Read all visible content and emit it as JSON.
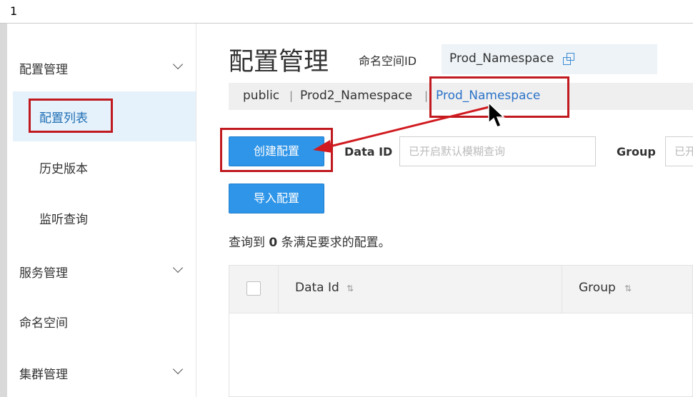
{
  "window": {
    "title_number": "1"
  },
  "sidebar": {
    "groups": [
      {
        "label": "配置管理"
      },
      {
        "label": "服务管理"
      },
      {
        "label": "命名空间"
      },
      {
        "label": "集群管理"
      }
    ],
    "items": [
      {
        "label": "配置列表",
        "active": true
      },
      {
        "label": "历史版本"
      },
      {
        "label": "监听查询"
      }
    ]
  },
  "header": {
    "title": "配置管理",
    "namespace_label": "命名空间ID",
    "namespace_value": "Prod_Namespace"
  },
  "namespace_tabs": [
    {
      "label": "public"
    },
    {
      "label": "Prod2_Namespace"
    },
    {
      "label": "Prod_Namespace",
      "active": true
    }
  ],
  "namespace_separator": "|",
  "toolbar": {
    "create_label": "创建配置",
    "import_label": "导入配置",
    "data_id_label": "Data ID",
    "data_id_placeholder": "已开启默认模糊查询",
    "group_label": "Group",
    "group_placeholder": "已开启默认模糊查询"
  },
  "result": {
    "prefix": "查询到",
    "count": "0",
    "suffix": "条满足要求的配置。"
  },
  "table": {
    "columns": [
      {
        "label": "Data Id"
      },
      {
        "label": "Group"
      }
    ],
    "sort_glyph": "⇅",
    "rows": []
  },
  "colors": {
    "primary": "#2f95e8",
    "active_link": "#2a72c8",
    "annotation": "#c0191f"
  }
}
